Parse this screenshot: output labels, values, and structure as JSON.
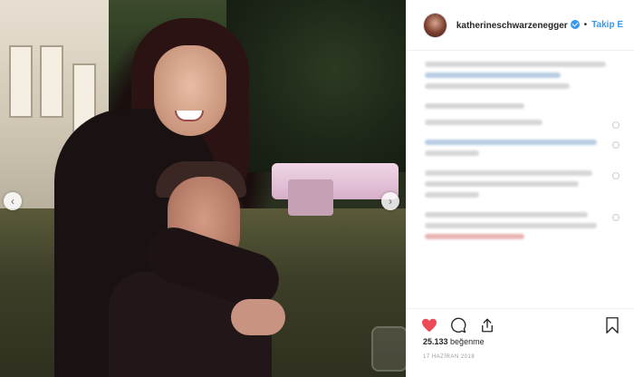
{
  "post": {
    "username": "katherineschwarzenegger",
    "follow_label": "Takip E",
    "dot": "•",
    "likes_count": "25.133",
    "likes_word": "beğenme",
    "date": "17 HAZİRAN 2018"
  },
  "icons": {
    "heart": "heart-icon",
    "comment": "comment-icon",
    "share": "share-icon",
    "bookmark": "bookmark-icon",
    "verified": "verified-badge-icon",
    "prev": "chevron-left-icon",
    "next": "chevron-right-icon"
  },
  "colors": {
    "heart": "#ed4956",
    "link": "#3897f0",
    "text": "#262626",
    "muted": "#999999"
  },
  "nav": {
    "prev": "‹",
    "next": "›"
  }
}
